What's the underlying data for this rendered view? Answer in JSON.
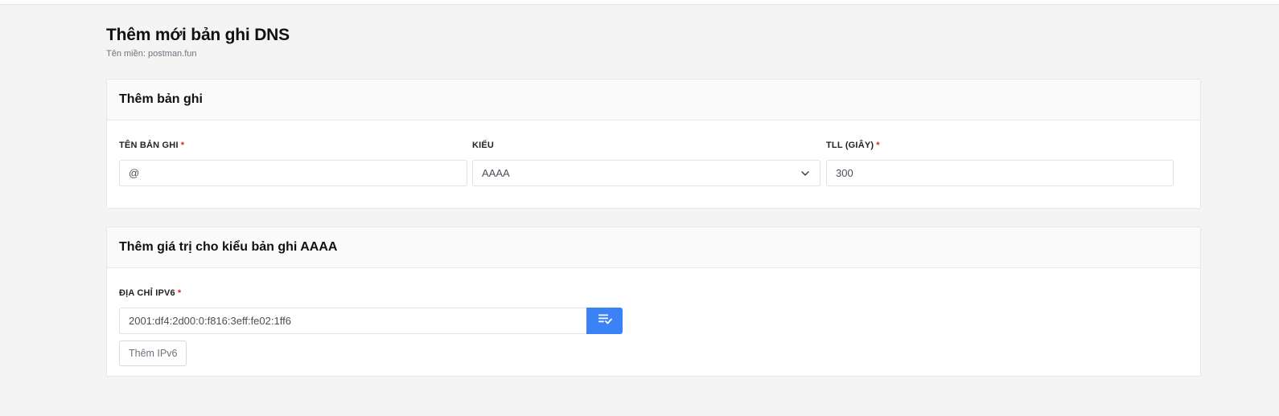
{
  "header": {
    "title": "Thêm mới bản ghi DNS",
    "subtitle_label": "Tên miền:",
    "domain": "postman.fun"
  },
  "record_card": {
    "title": "Thêm bản ghi",
    "name_field": {
      "label": "TÊN BẢN GHI",
      "required_mark": "*",
      "value": "@"
    },
    "type_field": {
      "label": "KIỂU",
      "value": "AAAA",
      "icon": "chevron-down-icon"
    },
    "ttl_field": {
      "label": "TLL (GIÂY)",
      "required_mark": "*",
      "value": "300"
    }
  },
  "value_card": {
    "title": "Thêm giá trị cho kiểu bản ghi AAAA",
    "ipv6_field": {
      "label": "ĐỊA CHỈ IPV6",
      "required_mark": "*",
      "value": "2001:df4:2d00:0:f816:3eff:fe02:1ff6",
      "action_icon": "playlist-check-icon"
    },
    "add_button_label": "Thêm IPv6"
  },
  "colors": {
    "accent": "#3b82f6",
    "required": "#e02424",
    "background": "#f4f4f4"
  }
}
